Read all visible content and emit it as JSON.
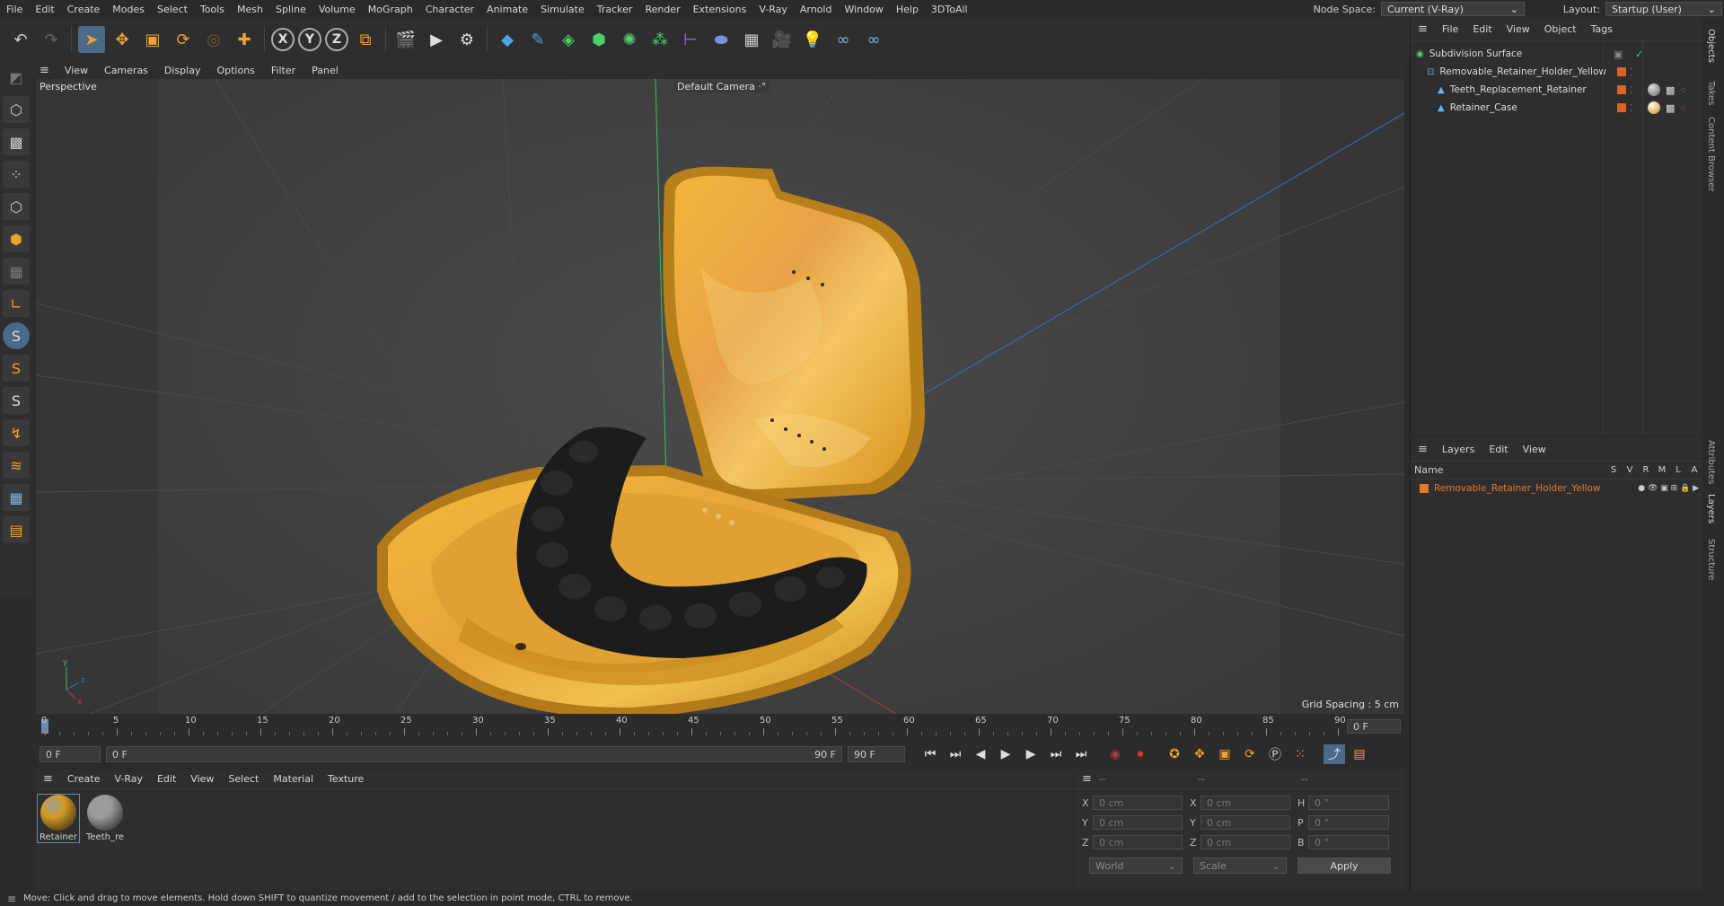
{
  "menu": [
    "File",
    "Edit",
    "Create",
    "Modes",
    "Select",
    "Tools",
    "Mesh",
    "Spline",
    "Volume",
    "MoGraph",
    "Character",
    "Animate",
    "Simulate",
    "Tracker",
    "Render",
    "Extensions",
    "V-Ray",
    "Arnold",
    "Window",
    "Help",
    "3DToAll"
  ],
  "node_space": {
    "label": "Node Space:",
    "value": "Current (V-Ray)"
  },
  "layout": {
    "label": "Layout:",
    "value": "Startup (User)"
  },
  "viewport": {
    "menu": [
      "View",
      "Cameras",
      "Display",
      "Options",
      "Filter",
      "Panel"
    ],
    "view_name": "Perspective",
    "camera": "Default Camera",
    "grid_spacing": "Grid Spacing : 5 cm"
  },
  "timeline": {
    "ticks": [
      "0",
      "5",
      "10",
      "15",
      "20",
      "25",
      "30",
      "35",
      "40",
      "45",
      "50",
      "55",
      "60",
      "65",
      "70",
      "75",
      "80",
      "85",
      "90"
    ],
    "frame_display": "0 F"
  },
  "transport": {
    "start_frame": "0 F",
    "current_frame": "0 F",
    "end_frame_field": "90 F",
    "end_frame": "90 F"
  },
  "materials": {
    "menu": [
      "Create",
      "V-Ray",
      "Edit",
      "View",
      "Select",
      "Material",
      "Texture"
    ],
    "items": [
      {
        "name": "Retainer",
        "color": "#d49a22"
      },
      {
        "name": "Teeth_re",
        "color": "#9a9a9a"
      }
    ]
  },
  "coords": {
    "header": [
      "--",
      "--",
      "--"
    ],
    "rows": [
      {
        "a": "X",
        "av": "0 cm",
        "b": "X",
        "bv": "0 cm",
        "c": "H",
        "cv": "0 °"
      },
      {
        "a": "Y",
        "av": "0 cm",
        "b": "Y",
        "bv": "0 cm",
        "c": "P",
        "cv": "0 °"
      },
      {
        "a": "Z",
        "av": "0 cm",
        "b": "Z",
        "bv": "0 cm",
        "c": "B",
        "cv": "0 °"
      }
    ],
    "world": "World",
    "scale": "Scale",
    "apply": "Apply"
  },
  "objects": {
    "menu": [
      "File",
      "Edit",
      "View",
      "Object",
      "Tags"
    ],
    "items": [
      {
        "name": "Subdivision Surface",
        "level": 0
      },
      {
        "name": "Removable_Retainer_Holder_Yellow",
        "level": 1
      },
      {
        "name": "Teeth_Replacement_Retainer",
        "level": 2
      },
      {
        "name": "Retainer_Case",
        "level": 2
      }
    ]
  },
  "layers": {
    "menu": [
      "Layers",
      "Edit",
      "View"
    ],
    "col_name": "Name",
    "cols": [
      "S",
      "V",
      "R",
      "M",
      "L",
      "A"
    ],
    "items": [
      {
        "name": "Removable_Retainer_Holder_Yellow",
        "color": "#e07a2a"
      }
    ]
  },
  "side_tabs": [
    "Objects",
    "Takes",
    "Content Browser",
    "Attributes",
    "Layers",
    "Structure"
  ],
  "status": "Move: Click and drag to move elements. Hold down SHIFT to quantize movement / add to the selection in point mode, CTRL to remove."
}
